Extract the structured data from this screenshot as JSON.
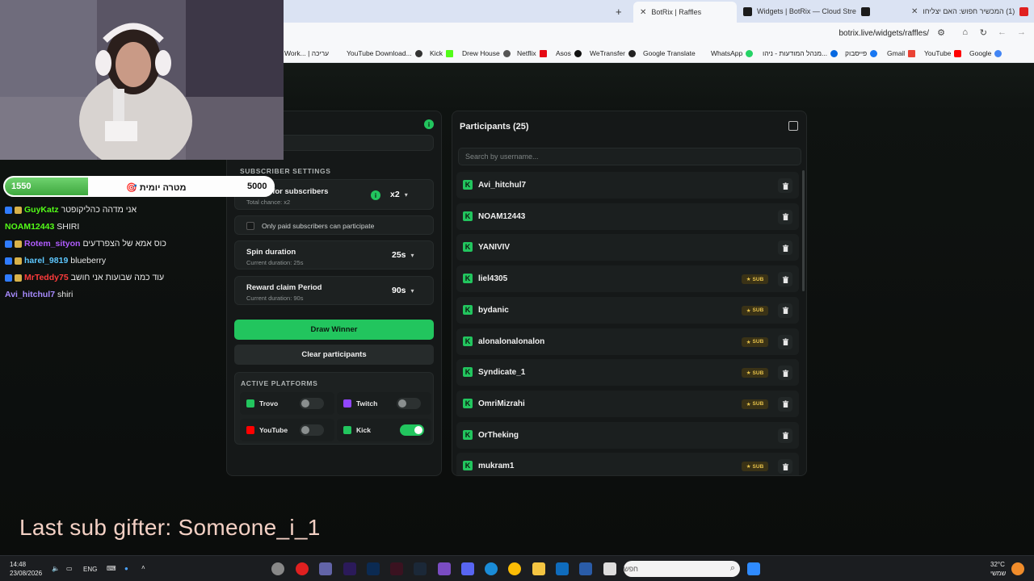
{
  "browser": {
    "tabs": [
      {
        "label": "(1) המכשיר חפוש: האם יצליחו",
        "active": false
      },
      {
        "label": "Widgets | BotRix — Cloud Stre",
        "active": false
      },
      {
        "label": "BotRix | Raffles",
        "active": true
      }
    ],
    "url": "botrix.live/widgets/raffles/",
    "bookmarks": [
      "Google",
      "YouTube",
      "Gmail",
      "פייסבוק",
      "מנהל המודעות - ניהו...",
      "WhatsApp",
      "Google Translate",
      "WeTransfer",
      "Asos",
      "Netflix",
      "Drew House",
      "Kick",
      "YouTube Download...",
      "Work... | עריכה"
    ]
  },
  "settings": {
    "subscriber_section": "SUBSCRIBER SETTINGS",
    "bonus_title": "Bonus for subscribers",
    "bonus_sub": "Total chance: x2",
    "bonus_value": "x2",
    "only_paid_label": "Only paid subscribers can participate",
    "spin_title": "Spin duration",
    "spin_sub": "Current duration: 25s",
    "spin_value": "25s",
    "reward_title": "Reward claim Period",
    "reward_sub": "Current duration: 90s",
    "reward_value": "90s",
    "draw_button": "Draw Winner",
    "clear_button": "Clear participants",
    "platforms_section": "ACTIVE PLATFORMS",
    "platforms": [
      {
        "name": "Trovo",
        "enabled": false,
        "color": "#22c55e"
      },
      {
        "name": "Twitch",
        "enabled": false,
        "color": "#9146ff"
      },
      {
        "name": "YouTube",
        "enabled": false,
        "color": "#ff0000"
      },
      {
        "name": "Kick",
        "enabled": true,
        "color": "#22c55e"
      }
    ]
  },
  "participants": {
    "title": "Participants (25)",
    "search_placeholder": "Search by username...",
    "sub_label": "SUB",
    "list": [
      {
        "name": "Avi_hitchul7",
        "sub": false
      },
      {
        "name": "NOAM12443",
        "sub": false
      },
      {
        "name": "YANIVIV",
        "sub": false
      },
      {
        "name": "liel4305",
        "sub": true
      },
      {
        "name": "bydanic",
        "sub": true
      },
      {
        "name": "alonalonalonalon",
        "sub": true
      },
      {
        "name": "Syndicate_1",
        "sub": true
      },
      {
        "name": "OmriMizrahi",
        "sub": true
      },
      {
        "name": "OrTheking",
        "sub": false
      },
      {
        "name": "mukram1",
        "sub": true
      }
    ]
  },
  "overlay": {
    "goal_current": "1550",
    "goal_target": "5000",
    "goal_label": "מטרה יומית",
    "goal_progress": 0.31,
    "last_sub": "Last sub gifter: Someone_i_1",
    "chat": [
      {
        "user": "GuyKatz",
        "msg": "אני מדהה כהליקופטר",
        "color": "#53fc18"
      },
      {
        "user": "NOAM12443",
        "msg": "SHIRI",
        "color": "#53fc18"
      },
      {
        "user": "Rotem_sityon",
        "msg": "כוס אמא של הצפרדעים",
        "color": "#b15cff"
      },
      {
        "user": "harel_9819",
        "msg": "blueberry",
        "color": "#5ec8ff"
      },
      {
        "user": "MrTeddy75",
        "msg": "עוד כמה שבועות אני חושב",
        "color": "#ff3b3b"
      },
      {
        "user": "Avi_hitchul7",
        "msg": "shiri",
        "color": "#a88bff"
      }
    ]
  },
  "taskbar": {
    "time": "14:48",
    "date": "23/08/2026",
    "lang": "ENG",
    "search_placeholder": "חפש",
    "temp": "32°C",
    "weather": "שמשי"
  }
}
